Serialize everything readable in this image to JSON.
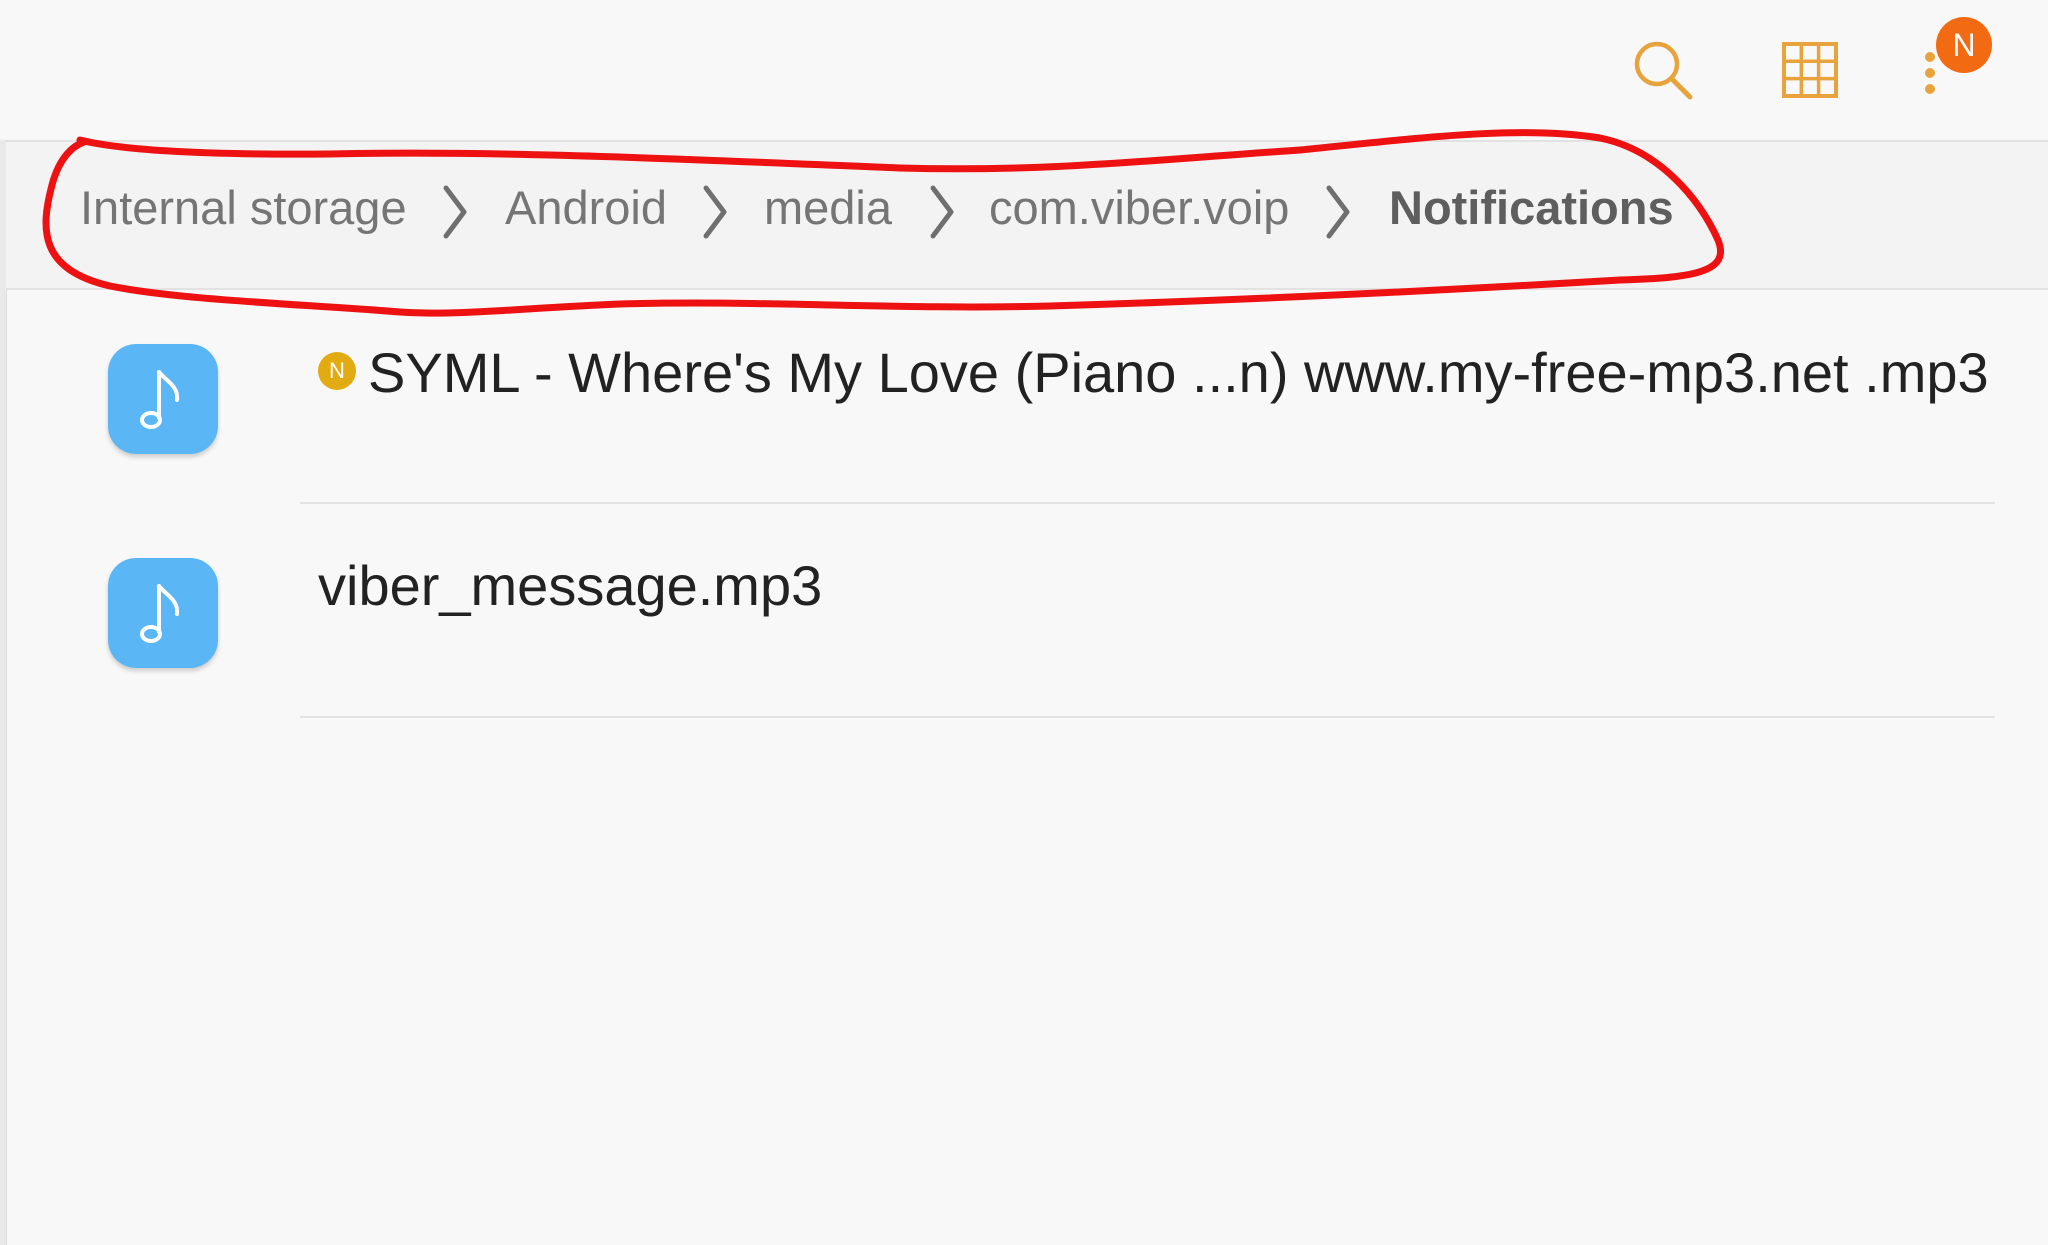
{
  "toolbar": {
    "search_icon": "search-icon",
    "grid_icon": "grid-view-icon",
    "more_icon": "more-options-icon",
    "notification_badge": "N",
    "accent_color": "#e8a33d",
    "badge_color": "#f26a12"
  },
  "breadcrumb": {
    "items": [
      {
        "label": "Internal storage"
      },
      {
        "label": "Android"
      },
      {
        "label": "media"
      },
      {
        "label": "com.viber.voip"
      },
      {
        "label": "Notifications"
      }
    ],
    "annotation_color": "#ee1111"
  },
  "files": [
    {
      "name": "SYML - Where's My Love (Piano ...n) www.my-free-mp3.net .mp3",
      "new_badge": "N",
      "icon": "music-note-icon"
    },
    {
      "name": "viber_message.mp3",
      "icon": "music-note-icon"
    }
  ],
  "colors": {
    "file_icon_bg": "#5ab6f4",
    "new_badge": "#e3ab12",
    "background": "#f8f8f8"
  }
}
